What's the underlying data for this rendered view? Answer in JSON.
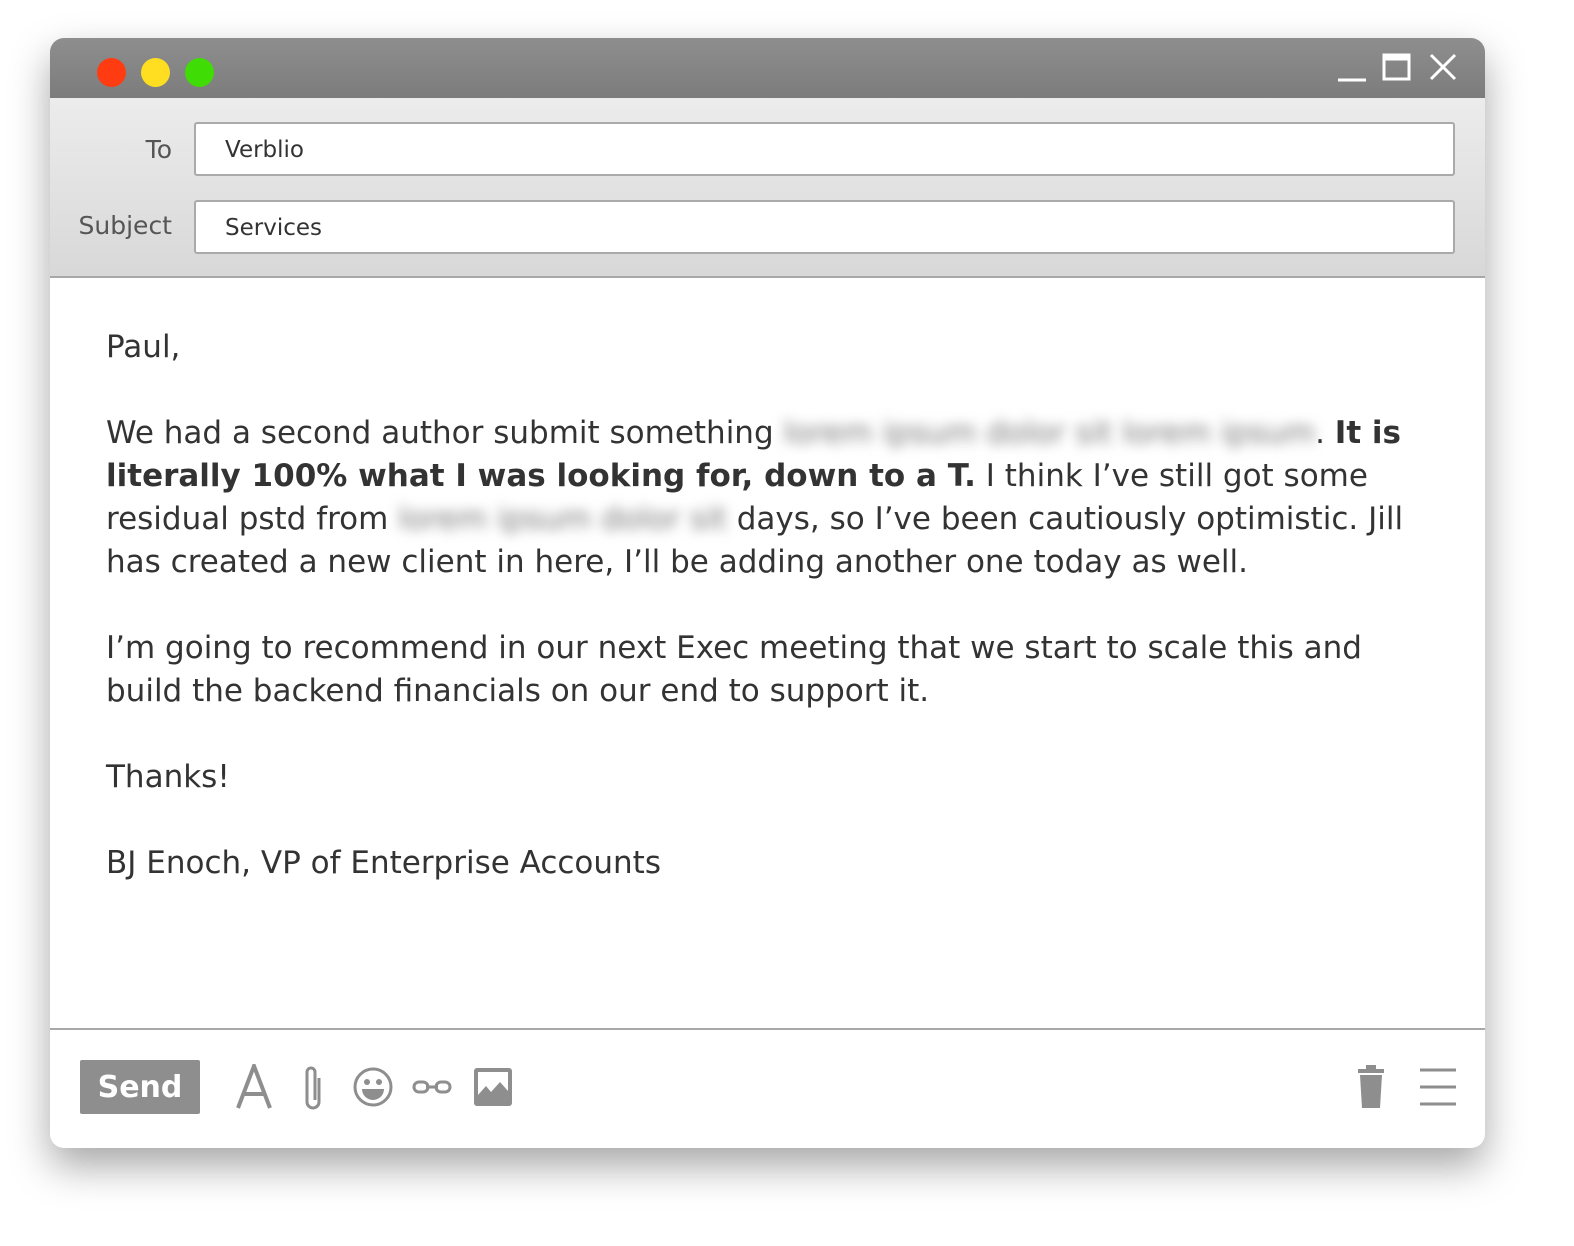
{
  "window": {
    "controls": {
      "close_color": "#ff3b12",
      "minimize_color": "#ffde21",
      "maximize_color": "#3fdc06"
    }
  },
  "header": {
    "to_label": "To",
    "to_value": "Verblio",
    "subject_label": "Subject",
    "subject_value": "Services"
  },
  "body": {
    "greeting": "Paul,",
    "p1_a": "We had a second author submit something ",
    "p1_blur1": "lorem ipsum dolor sit lorem ipsum",
    "p1_b": ". ",
    "p1_bold": "It is literally 100% what I was looking for, down to a T.",
    "p1_c": " I think I’ve still got some residual pstd from ",
    "p1_blur2": "lorem ipsum dolor sit",
    "p1_d": " days, so I’ve been cautiously optimistic. Jill has created a new client in here, I’ll be adding another one today as well.",
    "p2": "I’m going to recommend in our next Exec meeting that we start to scale this and build the backend financials on our end to support it.",
    "thanks": "Thanks!",
    "signature": "BJ Enoch, VP of Enterprise Accounts"
  },
  "footer": {
    "send_label": "Send",
    "icons": [
      "font-icon",
      "paperclip-icon",
      "emoji-icon",
      "link-icon",
      "image-icon",
      "trash-icon",
      "menu-icon"
    ]
  }
}
